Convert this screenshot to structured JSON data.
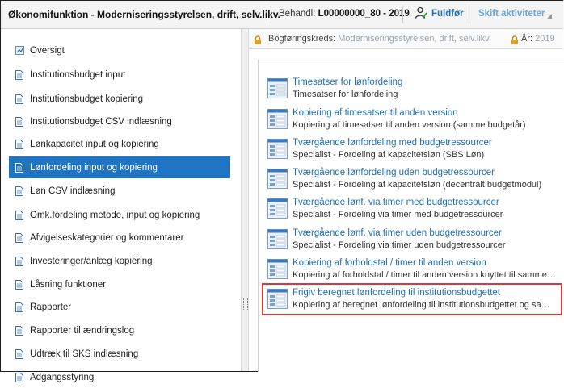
{
  "header": {
    "app_title": "Økonomifunktion - Moderniseringsstyrelsen, drift, selv.likv.",
    "behandl_label": "Behandl:",
    "behandl_value": "L00000000_80 - 2019",
    "finish_label": "Fuldfør",
    "shift_label": "Skift aktiviteter"
  },
  "sidebar": {
    "items": [
      {
        "label": "Oversigt",
        "icon": "overview-icon",
        "active": false
      },
      {
        "label": "Institutionsbudget input",
        "icon": "document-icon",
        "active": false
      },
      {
        "label": "Institutionsbudget kopiering",
        "icon": "document-icon",
        "active": false
      },
      {
        "label": "Institutionsbudget CSV indlæsning",
        "icon": "document-icon",
        "active": false
      },
      {
        "label": "Lønkapacitet input og kopiering",
        "icon": "document-icon",
        "active": false
      },
      {
        "label": "Lønfordeling input og kopiering",
        "icon": "document-icon",
        "active": true
      },
      {
        "label": "Løn CSV indlæsning",
        "icon": "document-icon",
        "active": false
      },
      {
        "label": "Omk.fordeling metode, input og kopiering",
        "icon": "document-icon",
        "active": false
      },
      {
        "label": "Afvigelseskategorier og kommentarer",
        "icon": "document-icon",
        "active": false
      },
      {
        "label": "Investeringer/anlæg kopiering",
        "icon": "document-icon",
        "active": false
      },
      {
        "label": "Låsning funktioner",
        "icon": "document-icon",
        "active": false
      },
      {
        "label": "Rapporter",
        "icon": "document-icon",
        "active": false
      },
      {
        "label": "Rapporter til ændringslog",
        "icon": "document-icon",
        "active": false
      },
      {
        "label": "Udtræk til SKS indlæsning",
        "icon": "document-icon",
        "active": false
      },
      {
        "label": "Adgangsstyring",
        "icon": "document-icon",
        "active": false
      }
    ]
  },
  "infobar": {
    "bogforingskreds_label": "Bogføringskreds:",
    "bogforingskreds_value": "Moderniseringsstyrelsen, drift, selv.likv.",
    "aar_label": "År:",
    "aar_value": "2019"
  },
  "tiles": [
    {
      "title": "Timesatser for lønfordeling",
      "desc": "Timesatser for lønfordeling",
      "selected": false
    },
    {
      "title": "Kopiering af timesatser til anden version",
      "desc": "Kopiering af timesatser til anden version (samme budgetår)",
      "selected": false
    },
    {
      "title": "Tværgående lønfordeling med budgetressourcer",
      "desc": "Specialist - Fordeling af kapacitetsløn (SBS Løn)",
      "selected": false
    },
    {
      "title": "Tværgående lønfordeling uden budgetressourcer",
      "desc": "Specialist - Fordeling af kapacitetsløn (decentralt budgetmodul)",
      "selected": false
    },
    {
      "title": "Tværgående lønf. via timer med budgetressourcer",
      "desc": "Specialist - Fordeling via timer med budgetressourcer",
      "selected": false
    },
    {
      "title": "Tværgående lønf. via timer uden budgetressourcer",
      "desc": "Specialist - Fordeling via timer uden budgetressourcer",
      "selected": false
    },
    {
      "title": "Kopiering af forholdstal / timer til anden version",
      "desc": "Kopiering af forholdstal / timer til anden version knyttet til samme…",
      "selected": false
    },
    {
      "title": "Frigiv beregnet lønfordeling til institutionsbudgettet",
      "desc": "Kopiering af beregnet lønfordeling til institutionsbudgettet og sam…",
      "selected": true
    }
  ],
  "colors": {
    "accent": "#1f74c3",
    "link": "#1f6fb4",
    "selection_outline": "#d63a3a",
    "lock": "#e0a020"
  }
}
